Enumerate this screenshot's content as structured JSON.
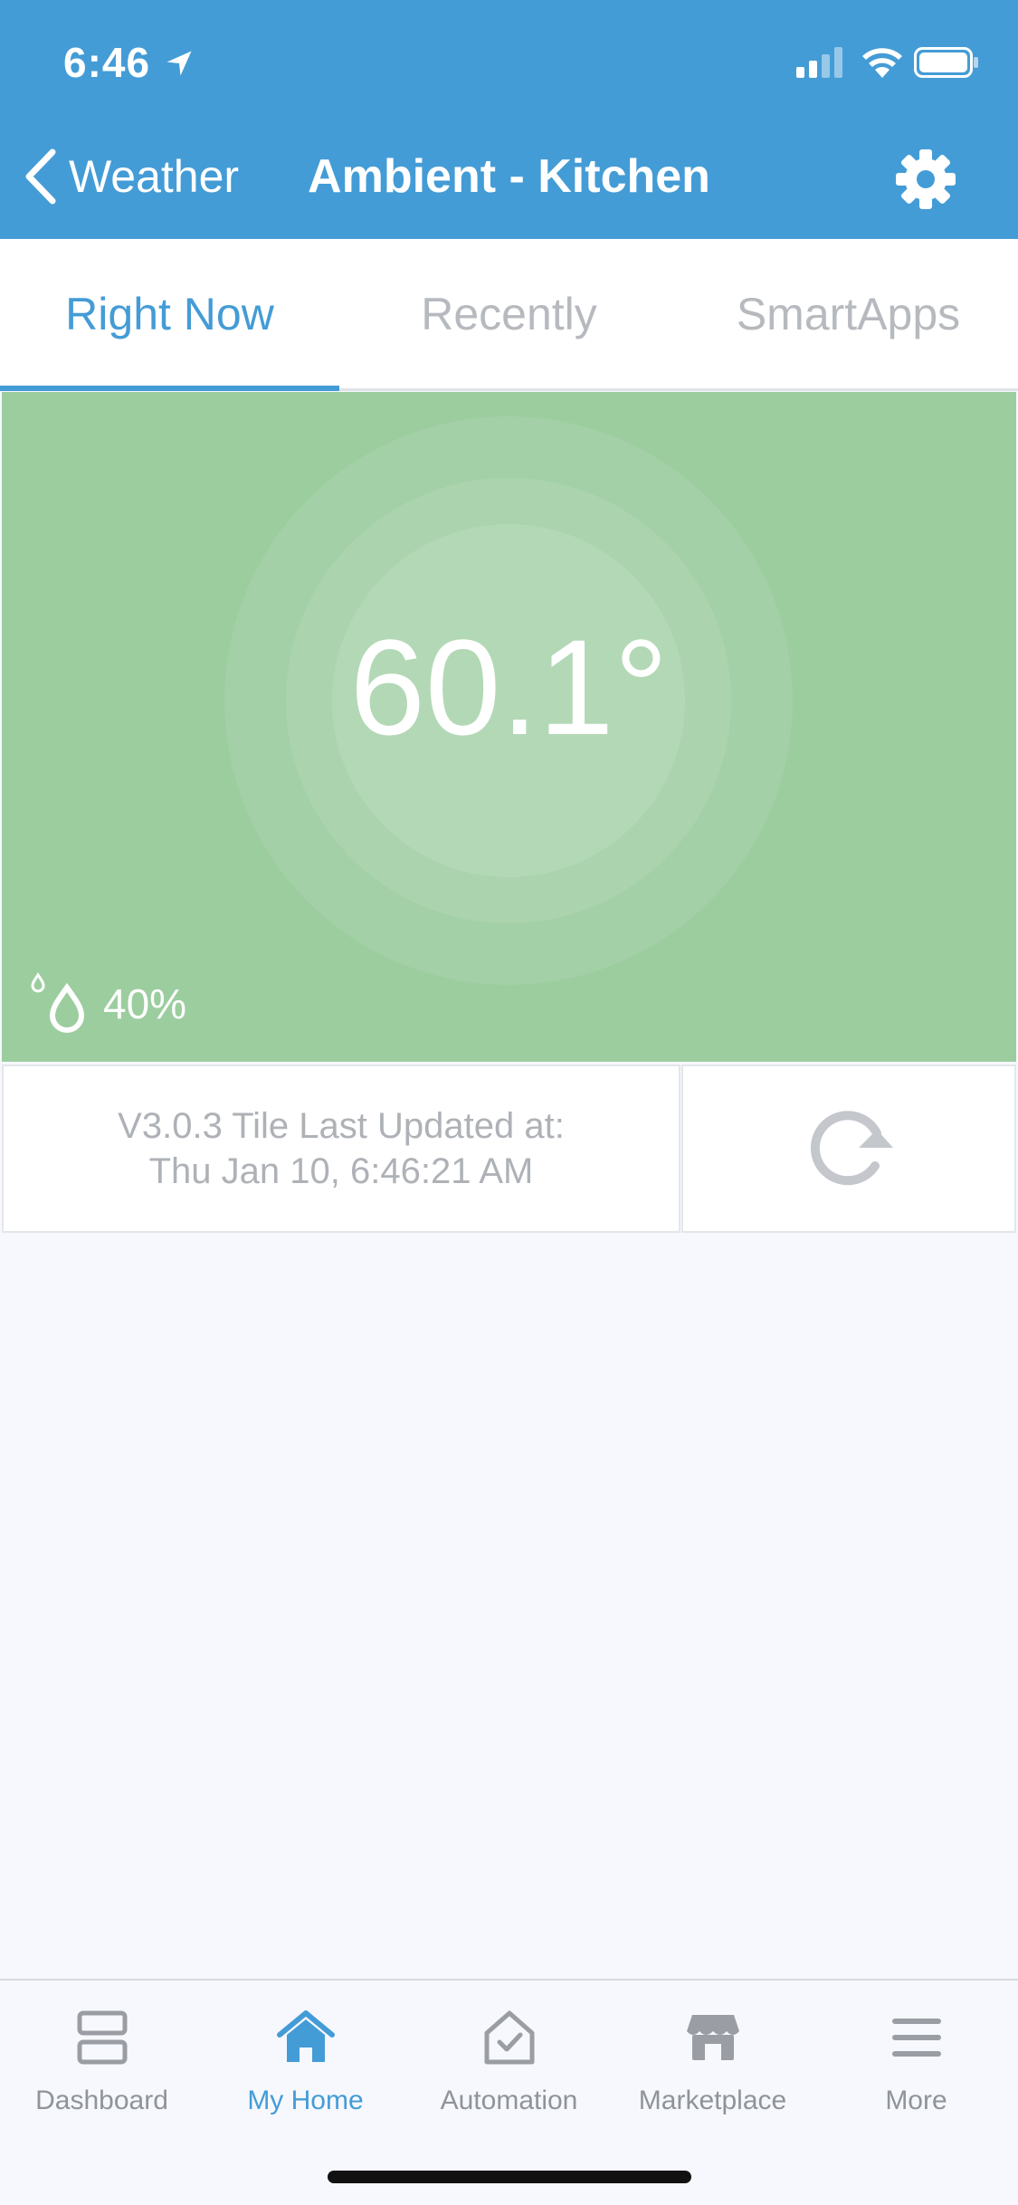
{
  "status_bar": {
    "time": "6:46",
    "icons": [
      "location-arrow-icon",
      "signal-icon",
      "wifi-icon",
      "battery-icon"
    ]
  },
  "nav_bar": {
    "back_label": "Weather",
    "title": "Ambient - Kitchen",
    "settings_icon": "gear-icon"
  },
  "tabs": [
    {
      "label": "Right Now",
      "active": true
    },
    {
      "label": "Recently",
      "active": false
    },
    {
      "label": "SmartApps",
      "active": false
    }
  ],
  "tile": {
    "temperature": "60.1°",
    "humidity": "40%",
    "humidity_icon": "water-drops-icon",
    "background_color": "#9ccd9f"
  },
  "info": {
    "line1": "V3.0.3 Tile Last Updated at:",
    "line2": "Thu Jan 10, 6:46:21 AM",
    "refresh_icon": "refresh-icon"
  },
  "bottom_nav": [
    {
      "label": "Dashboard",
      "icon": "dashboard-icon",
      "active": false
    },
    {
      "label": "My Home",
      "icon": "home-icon",
      "active": true
    },
    {
      "label": "Automation",
      "icon": "automation-icon",
      "active": false
    },
    {
      "label": "Marketplace",
      "icon": "marketplace-icon",
      "active": false
    },
    {
      "label": "More",
      "icon": "menu-icon",
      "active": false
    }
  ],
  "colors": {
    "accent": "#449cd6",
    "inactive": "#b6babf",
    "tile_green": "#9ccd9f"
  }
}
